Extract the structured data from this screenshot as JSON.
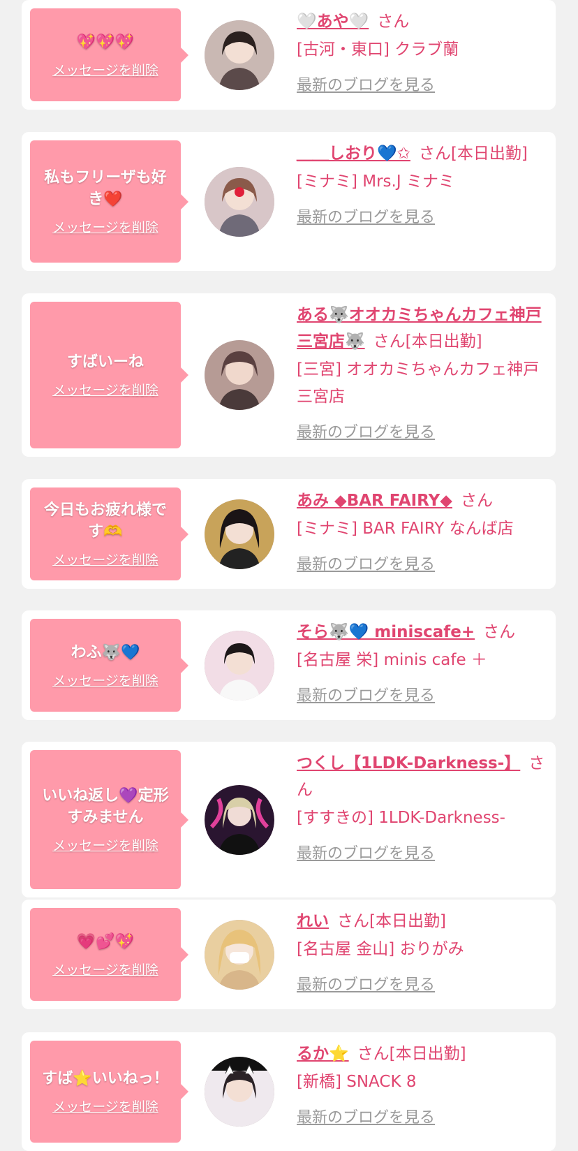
{
  "items": [
    {
      "message": "💖💖💖",
      "delete_label": "メッセージを削除",
      "name": "🤍あや🤍",
      "san": "さん",
      "status": "",
      "shop": "[古河・東口] クラブ蘭",
      "blog_label": "最新のブログを見る"
    },
    {
      "message": "私もフリーザも好き❤️",
      "delete_label": "メッセージを削除",
      "name": "＿＿しおり💙✩",
      "san": "さん",
      "status": "[本日出勤]",
      "shop": "[ミナミ] Mrs.J ミナミ",
      "blog_label": "最新のブログを見る"
    },
    {
      "message": "すばいーね",
      "delete_label": "メッセージを削除",
      "name": "ある🐺オオカミちゃんカフェ神戸三宮店🐺",
      "san": "さん",
      "status": "[本日出勤]",
      "shop": "[三宮] オオカミちゃんカフェ神戸三宮店",
      "blog_label": "最新のブログを見る"
    },
    {
      "message": "今日もお疲れ様です🫶",
      "delete_label": "メッセージを削除",
      "name": "あみ ◆BAR FAIRY◆",
      "san": "さん",
      "status": "",
      "shop": "[ミナミ] BAR FAIRY なんば店",
      "blog_label": "最新のブログを見る"
    },
    {
      "message": "わふ🐺💙",
      "delete_label": "メッセージを削除",
      "name": "そら🐺💙 miniscafe+",
      "san": "さん",
      "status": "",
      "shop": "[名古屋 栄] minis cafe ＋",
      "blog_label": "最新のブログを見る"
    },
    {
      "message": "いいね返し💜定形すみません",
      "delete_label": "メッセージを削除",
      "name": "つくし【1LDK-Darkness-】",
      "san": "さん",
      "status": "",
      "shop": "[すすきの] 1LDK-Darkness-",
      "blog_label": "最新のブログを見る"
    },
    {
      "message": "💗💕💖",
      "delete_label": "メッセージを削除",
      "name": "れい",
      "san": "さん",
      "status": "[本日出勤]",
      "shop": "[名古屋 金山] おりがみ",
      "blog_label": "最新のブログを見る"
    },
    {
      "message": "すば⭐️いいねっ！",
      "delete_label": "メッセージを削除",
      "name": "るか⭐️",
      "san": "さん",
      "status": "[本日出勤]",
      "shop": "[新橋] SNACK 8",
      "blog_label": "最新のブログを見る"
    }
  ],
  "colors": {
    "page_background": "#f1f1f1",
    "card_background": "#ffffff",
    "bubble_pink": "#ff9aaa",
    "name_pink": "#e04570",
    "blog_gray": "#9a9a9a"
  }
}
